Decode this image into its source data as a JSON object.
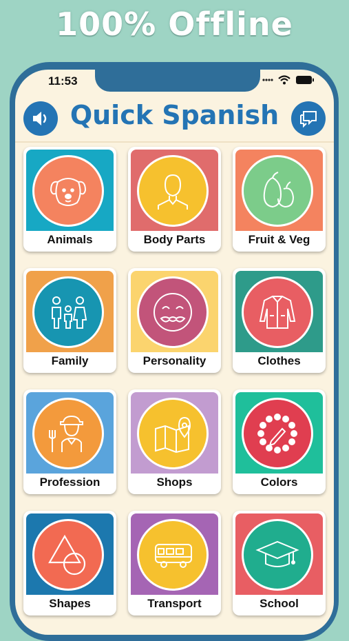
{
  "promo": {
    "headline": "100% Offline"
  },
  "status_bar": {
    "time": "11:53"
  },
  "header": {
    "title": "Quick Spanish",
    "left_icon": "speaker-icon",
    "right_icon": "chat-icon"
  },
  "categories": [
    {
      "label": "Animals",
      "icon": "dog-icon",
      "bg": "#17a8c4",
      "circle": "#f4835f"
    },
    {
      "label": "Body Parts",
      "icon": "person-icon",
      "bg": "#e06c6c",
      "circle": "#f6c12e"
    },
    {
      "label": "Fruit & Veg",
      "icon": "fruit-icon",
      "bg": "#f4835f",
      "circle": "#7ccc8a"
    },
    {
      "label": "Family",
      "icon": "family-icon",
      "bg": "#f0a14a",
      "circle": "#1795b1"
    },
    {
      "label": "Personality",
      "icon": "smiley-mustache-icon",
      "bg": "#fbd46e",
      "circle": "#c2547a"
    },
    {
      "label": "Clothes",
      "icon": "jacket-icon",
      "bg": "#2e9b8a",
      "circle": "#e85e63"
    },
    {
      "label": "Profession",
      "icon": "worker-icon",
      "bg": "#5aa4dc",
      "circle": "#f39a3c"
    },
    {
      "label": "Shops",
      "icon": "map-pin-icon",
      "bg": "#c29cd0",
      "circle": "#f6c12e"
    },
    {
      "label": "Colors",
      "icon": "palette-icon",
      "bg": "#1fbf9b",
      "circle": "#e03e50"
    },
    {
      "label": "Shapes",
      "icon": "shapes-icon",
      "bg": "#1c78ae",
      "circle": "#f26a52"
    },
    {
      "label": "Transport",
      "icon": "bus-icon",
      "bg": "#a565b4",
      "circle": "#f6c12e"
    },
    {
      "label": "School",
      "icon": "graduation-cap-icon",
      "bg": "#e85e63",
      "circle": "#20ad8e"
    }
  ]
}
